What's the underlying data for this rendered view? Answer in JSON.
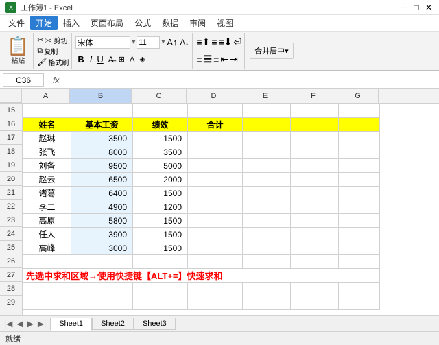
{
  "title": "工作簿1 - Excel",
  "menus": [
    "文件",
    "开始",
    "插入",
    "页面布局",
    "公式",
    "数据",
    "审阅",
    "视图"
  ],
  "active_menu": "开始",
  "toolbar": {
    "paste_label": "粘贴",
    "cut_label": "✂ 剪切",
    "copy_label": "复制",
    "format_label": "格式刷",
    "font_name": "宋体",
    "font_size": "11",
    "bold": "B",
    "italic": "I",
    "underline": "U",
    "font_color": "A",
    "merge_btn": "合并居中▾"
  },
  "formula_bar": {
    "cell_ref": "C36",
    "fx_label": "fx"
  },
  "columns": [
    "A",
    "B",
    "C",
    "D",
    "E",
    "F",
    "G"
  ],
  "rows": [
    {
      "num": 15,
      "cells": [
        "",
        "",
        "",
        "",
        "",
        "",
        ""
      ]
    },
    {
      "num": 16,
      "cells": [
        "姓名",
        "基本工资",
        "绩效",
        "合计",
        "",
        "",
        ""
      ],
      "header": true
    },
    {
      "num": 17,
      "cells": [
        "赵琳",
        "3500",
        "1500",
        "",
        "",
        "",
        ""
      ]
    },
    {
      "num": 18,
      "cells": [
        "张飞",
        "8000",
        "3500",
        "",
        "",
        "",
        ""
      ]
    },
    {
      "num": 19,
      "cells": [
        "刘备",
        "9500",
        "5000",
        "",
        "",
        "",
        ""
      ]
    },
    {
      "num": 20,
      "cells": [
        "赵云",
        "6500",
        "2000",
        "",
        "",
        "",
        ""
      ]
    },
    {
      "num": 21,
      "cells": [
        "诸葛",
        "6400",
        "1500",
        "",
        "",
        "",
        ""
      ]
    },
    {
      "num": 22,
      "cells": [
        "李二",
        "4900",
        "1200",
        "",
        "",
        "",
        ""
      ]
    },
    {
      "num": 23,
      "cells": [
        "高原",
        "5800",
        "1500",
        "",
        "",
        "",
        ""
      ]
    },
    {
      "num": 24,
      "cells": [
        "任人",
        "3900",
        "1500",
        "",
        "",
        "",
        ""
      ]
    },
    {
      "num": 25,
      "cells": [
        "高峰",
        "3000",
        "1500",
        "",
        "",
        "",
        ""
      ]
    },
    {
      "num": 26,
      "cells": [
        "",
        "",
        "",
        "",
        "",
        "",
        ""
      ]
    },
    {
      "num": 27,
      "cells": [
        "先选中求和区域→使用快捷键【ALT+=】快速求和",
        "",
        "",
        "",
        "",
        "",
        ""
      ],
      "instruction": true
    },
    {
      "num": 28,
      "cells": [
        "",
        "",
        "",
        "",
        "",
        "",
        ""
      ]
    },
    {
      "num": 29,
      "cells": [
        "",
        "",
        "",
        "",
        "",
        "",
        ""
      ]
    }
  ],
  "sheet_tabs": [
    "Sheet1",
    "Sheet2",
    "Sheet3"
  ],
  "active_tab": "Sheet1",
  "status": {
    "ready": "就绪"
  }
}
